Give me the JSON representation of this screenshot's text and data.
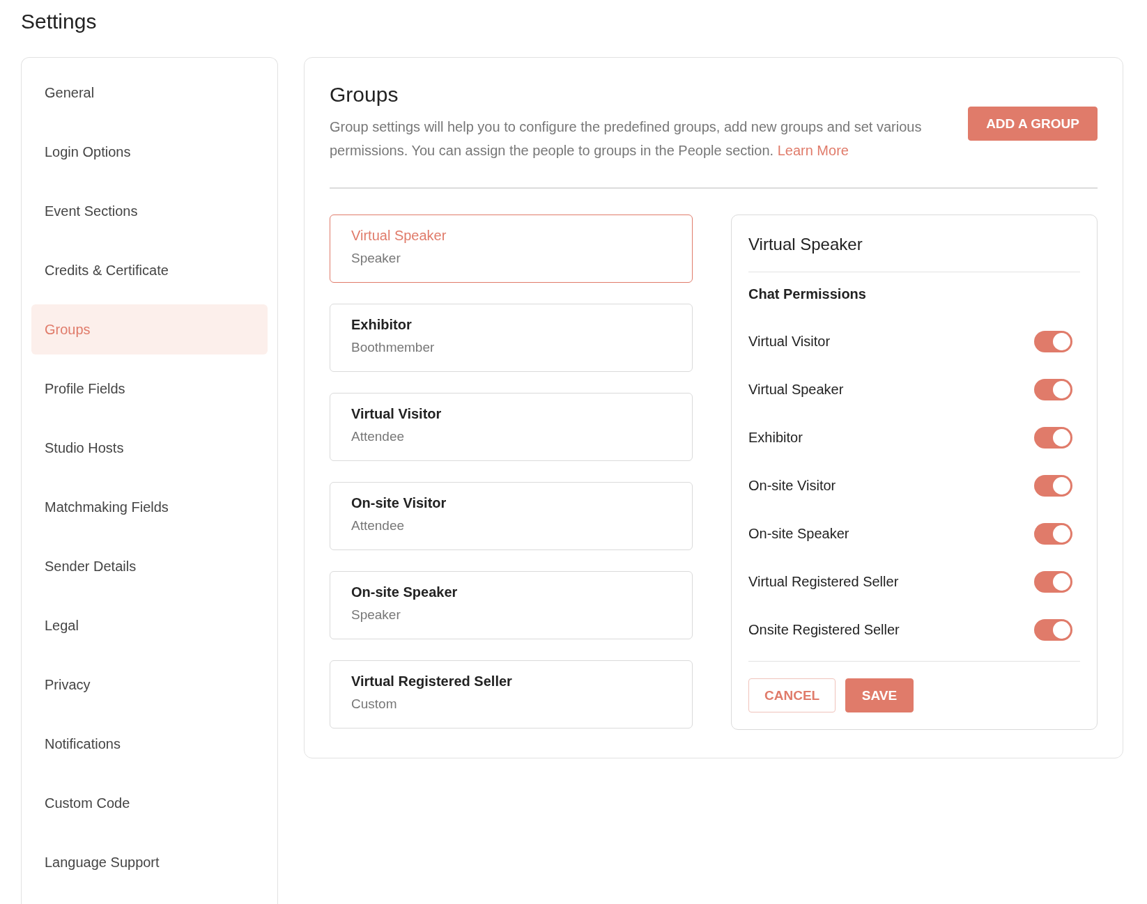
{
  "page_title": "Settings",
  "sidebar": {
    "items": [
      {
        "label": "General",
        "selected": false
      },
      {
        "label": "Login Options",
        "selected": false
      },
      {
        "label": "Event Sections",
        "selected": false
      },
      {
        "label": "Credits & Certificate",
        "selected": false
      },
      {
        "label": "Groups",
        "selected": true
      },
      {
        "label": "Profile Fields",
        "selected": false
      },
      {
        "label": "Studio Hosts",
        "selected": false
      },
      {
        "label": "Matchmaking Fields",
        "selected": false
      },
      {
        "label": "Sender Details",
        "selected": false
      },
      {
        "label": "Legal",
        "selected": false
      },
      {
        "label": "Privacy",
        "selected": false
      },
      {
        "label": "Notifications",
        "selected": false
      },
      {
        "label": "Custom Code",
        "selected": false
      },
      {
        "label": "Language Support",
        "selected": false
      }
    ]
  },
  "groups": {
    "heading": "Groups",
    "description": "Group settings will help you to configure the predefined groups, add new groups and set various permissions. You can assign the people to groups in the People section.",
    "learn_more": "Learn More",
    "add_button": "ADD A GROUP",
    "cards": [
      {
        "name": "Virtual Speaker",
        "role": "Speaker",
        "selected": true
      },
      {
        "name": "Exhibitor",
        "role": "Boothmember",
        "selected": false
      },
      {
        "name": "Virtual Visitor",
        "role": "Attendee",
        "selected": false
      },
      {
        "name": "On-site Visitor",
        "role": "Attendee",
        "selected": false
      },
      {
        "name": "On-site Speaker",
        "role": "Speaker",
        "selected": false
      },
      {
        "name": "Virtual Registered Seller",
        "role": "Custom",
        "selected": false
      }
    ],
    "detail": {
      "title": "Virtual Speaker",
      "section": "Chat Permissions",
      "permissions": [
        {
          "label": "Virtual Visitor",
          "on": true
        },
        {
          "label": "Virtual Speaker",
          "on": true
        },
        {
          "label": "Exhibitor",
          "on": true
        },
        {
          "label": "On-site Visitor",
          "on": true
        },
        {
          "label": "On-site Speaker",
          "on": true
        },
        {
          "label": "Virtual Registered Seller",
          "on": true
        },
        {
          "label": "Onsite Registered Seller",
          "on": true
        }
      ],
      "cancel": "CANCEL",
      "save": "SAVE"
    }
  }
}
